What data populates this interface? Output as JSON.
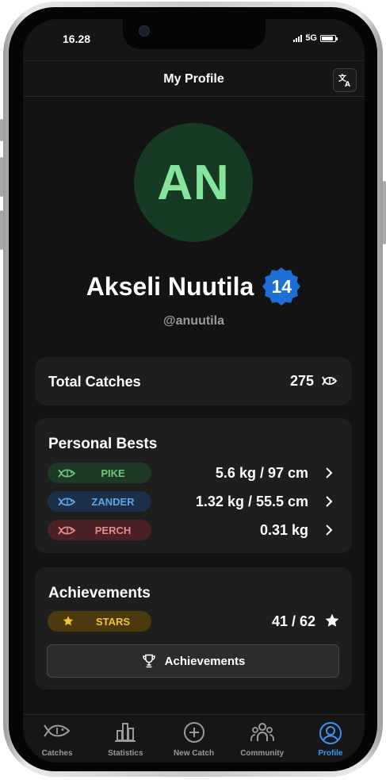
{
  "status_bar": {
    "time": "16.28",
    "network": "5G",
    "battery_level": 0.85
  },
  "header": {
    "title": "My Profile",
    "translate_icon": "translate-icon"
  },
  "profile": {
    "initials": "AN",
    "name": "Akseli Nuutila",
    "level": "14",
    "handle": "@anuutila",
    "colors": {
      "avatar_bg": "#173a22",
      "avatar_text": "#86e59c",
      "badge": "#1d6fd6"
    }
  },
  "total_catches": {
    "label": "Total Catches",
    "value": "275",
    "icon": "fish-icon"
  },
  "personal_bests": {
    "title": "Personal Bests",
    "items": [
      {
        "species": "PIKE",
        "value": "5.6 kg / 97 cm",
        "color": "#72c47c",
        "bg": "#1e3a24"
      },
      {
        "species": "ZANDER",
        "value": "1.32 kg / 55.5 cm",
        "color": "#60a5e8",
        "bg": "#1b2f48"
      },
      {
        "species": "PERCH",
        "value": "0.31 kg",
        "color": "#e88b8b",
        "bg": "#4a2124"
      }
    ]
  },
  "achievements": {
    "title": "Achievements",
    "stars_label": "STARS",
    "stars_value": "41 / 62",
    "button_label": "Achievements",
    "colors": {
      "pill_bg": "#4a3a0e",
      "pill_text": "#f0c23a"
    }
  },
  "tabbar": {
    "tabs": [
      {
        "label": "Catches",
        "icon": "fish-icon"
      },
      {
        "label": "Statistics",
        "icon": "bar-chart-icon"
      },
      {
        "label": "New Catch",
        "icon": "plus-circle-icon"
      },
      {
        "label": "Community",
        "icon": "people-icon"
      },
      {
        "label": "Profile",
        "icon": "user-circle-icon",
        "active": true
      }
    ]
  }
}
